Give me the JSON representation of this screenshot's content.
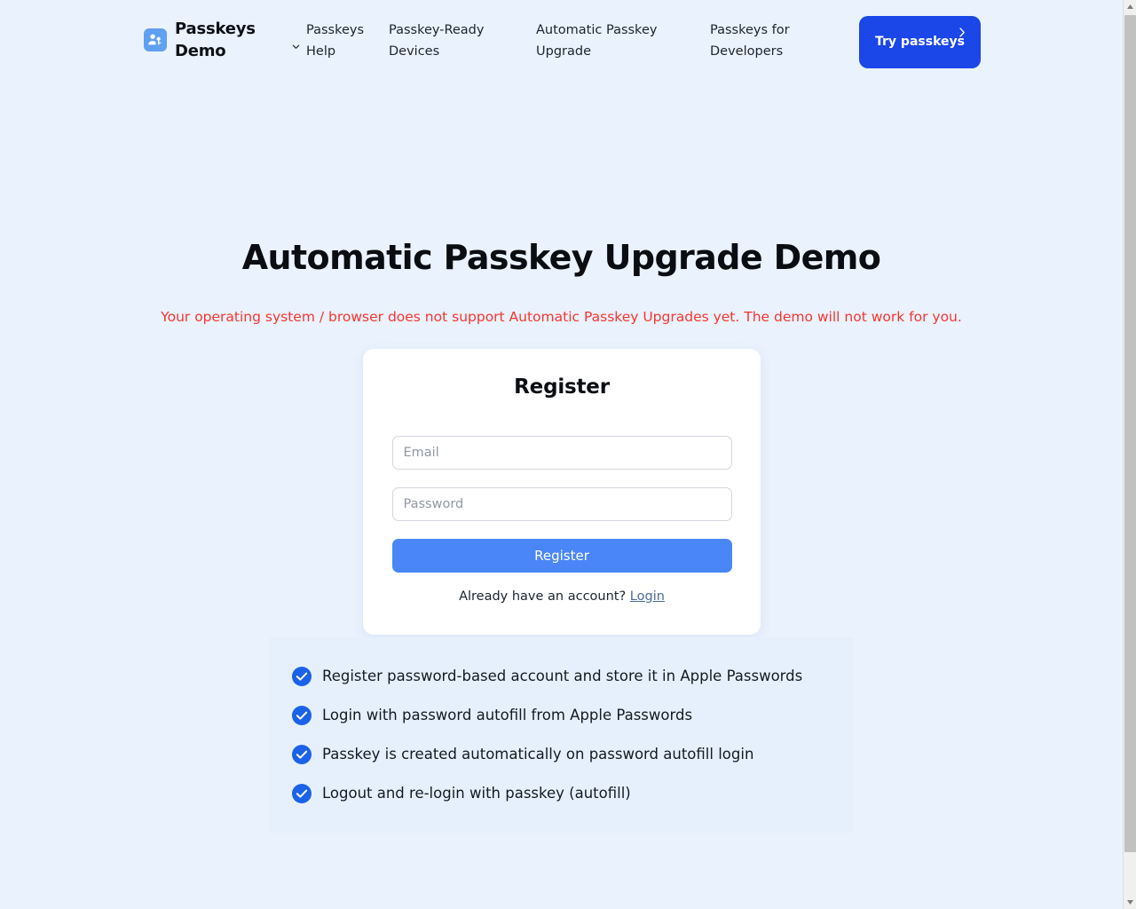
{
  "brand": {
    "name": "Passkeys Demo",
    "logo_icon": "person-key-icon",
    "logo_color": "#60a0f0"
  },
  "nav": {
    "items": [
      {
        "label": "Passkeys Help",
        "icon": "chevron-down-icon",
        "has_dropdown": true
      },
      {
        "label": "Passkey-Ready Devices",
        "has_dropdown": false
      },
      {
        "label": "Automatic Passkey Upgrade",
        "has_dropdown": false
      },
      {
        "label": "Passkeys for Developers",
        "has_dropdown": false
      }
    ],
    "cta": {
      "label": "Try passkeys",
      "icon": "chevron-right-icon",
      "color": "#1b46e8"
    }
  },
  "main": {
    "title": "Automatic Passkey Upgrade Demo",
    "warning": "Your operating system / browser does not support Automatic Passkey Upgrades yet. The demo will not work for you.",
    "warning_color": "#f5352f"
  },
  "auth_card": {
    "title": "Register",
    "email_placeholder": "Email",
    "email_value": "",
    "password_placeholder": "Password",
    "password_value": "",
    "submit_label": "Register",
    "submit_color": "#4a86f7",
    "footer_text": "Already have an account?",
    "footer_link": "Login"
  },
  "checklist": {
    "icon": "check-circle-icon",
    "icon_color": "#1b62e8",
    "items": [
      {
        "label": "Register password-based account and store it in Apple Passwords"
      },
      {
        "label": "Login with password autofill from Apple Passwords"
      },
      {
        "label": "Passkey is created automatically on password autofill login"
      },
      {
        "label": "Logout and re-login with passkey (autofill)"
      }
    ]
  },
  "scrollbar": {
    "up_icon": "triangle-up-icon",
    "down_icon": "triangle-down-icon"
  }
}
